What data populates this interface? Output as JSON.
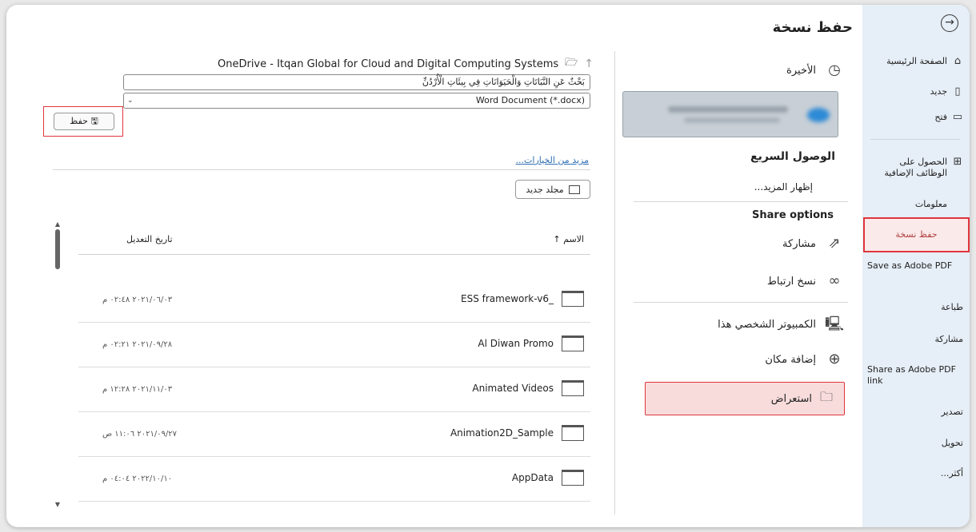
{
  "nav": {
    "back_icon": "arrow-right-circle-icon",
    "items": [
      {
        "label": "الصفحة الرئيسية",
        "icon": "⌂"
      },
      {
        "label": "جديد",
        "icon": "🗋"
      },
      {
        "label": "فتح",
        "icon": "🗁"
      },
      {
        "label": "الحصول على الوظائف الإضافية",
        "icon": "⊞"
      },
      {
        "label": "معلومات",
        "icon": ""
      },
      {
        "label": "حفظ نسخة",
        "icon": ""
      },
      {
        "label": "Save as Adobe PDF",
        "icon": ""
      },
      {
        "label": "طباعة",
        "icon": ""
      },
      {
        "label": "مشاركة",
        "icon": ""
      },
      {
        "label": "Share as Adobe PDF link",
        "icon": ""
      },
      {
        "label": "تصدير",
        "icon": ""
      },
      {
        "label": "تحويل",
        "icon": ""
      },
      {
        "label": "أكثر...",
        "icon": ""
      }
    ]
  },
  "middle": {
    "title": "حفظ نسخة",
    "recent": "الأخيرة",
    "quick_access": "الوصول السريع",
    "show_more": "إظهار المزيد...",
    "share_options": "Share options",
    "share": "مشاركة",
    "copy_link": "نسخ ارتباط",
    "this_pc": "الكمبيوتر الشخصي هذا",
    "add_place": "إضافة مكان",
    "browse": "استعراض"
  },
  "left": {
    "path": "OneDrive - Itqan Global for Cloud and Digital Computing Systems",
    "filename": "بَحْثٌ عَنِ النَّبَاتَاتِ وَالْحَيَوَانَاتِ فِي بِيئَاتِ الْأُرْدُنِّ",
    "filetype": "Word Document (*.docx)",
    "save_label": "حفظ",
    "more_options": "مزيد من الخيارات...",
    "new_folder": "مجلد جديد",
    "col_name": "الاسم",
    "col_date": "تاريخ التعديل",
    "rows": [
      {
        "name": "ESS framework-v6_",
        "date": "٢٠٢١/٠٦/٠٣ ٠٢:٤٨ م"
      },
      {
        "name": "Al Diwan Promo",
        "date": "٢٠٢١/٠٩/٢٨ ٠٢:٢١ م"
      },
      {
        "name": "Animated Videos",
        "date": "٢٠٢١/١١/٠٣ ١٢:٢٨ م"
      },
      {
        "name": "Animation2D_Sample",
        "date": "٢٠٢١/٠٩/٢٧ ١١:٠٦ ص"
      },
      {
        "name": "AppData",
        "date": "٢٠٢٢/١٠/١٠ ٠٤:٠٤ م"
      }
    ]
  },
  "accent": "#e0353c"
}
